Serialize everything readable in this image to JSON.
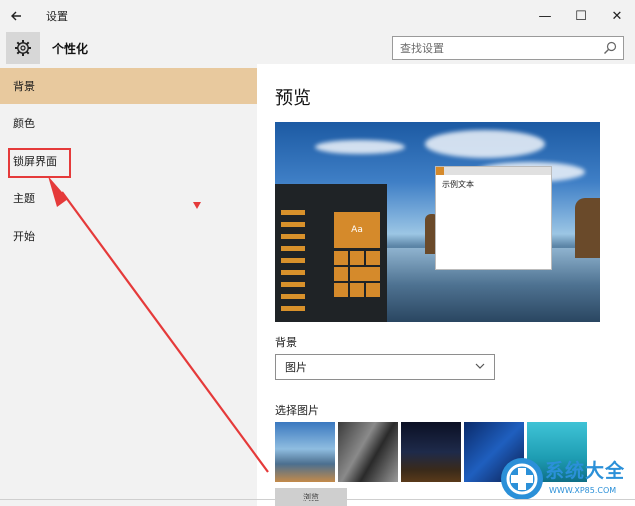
{
  "window": {
    "title": "设置",
    "back_icon": "back-arrow-icon",
    "controls": {
      "minimize": "—",
      "maximize": "☐",
      "close": "✕"
    }
  },
  "header": {
    "section_title": "个性化",
    "icon": "gear-icon",
    "search": {
      "placeholder": "查找设置",
      "value": ""
    }
  },
  "sidebar": {
    "items": [
      {
        "label": "背景",
        "selected": true
      },
      {
        "label": "颜色",
        "selected": false
      },
      {
        "label": "锁屏界面",
        "selected": false
      },
      {
        "label": "主题",
        "selected": false
      },
      {
        "label": "开始",
        "selected": false
      }
    ]
  },
  "main": {
    "preview_title": "预览",
    "preview_sample_text": "示例文本",
    "tile_label": "Aa",
    "background_label": "背景",
    "background_select": {
      "selected": "图片"
    },
    "choose_picture_label": "选择图片",
    "browse_label": "浏览"
  },
  "watermark": {
    "text": "系统大全",
    "url": "WWW.XP85.COM"
  },
  "colors": {
    "selected_nav": "#e8c99e",
    "accent": "#d58a2b",
    "annotation_red": "#e53a3a",
    "watermark_blue": "#2b90d8"
  }
}
